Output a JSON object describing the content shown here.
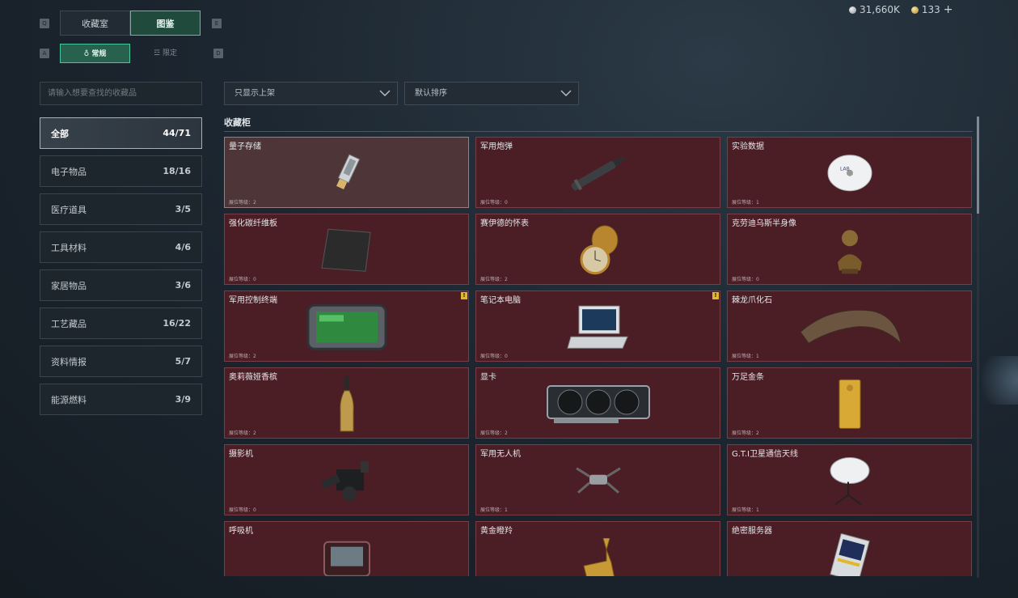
{
  "currency": {
    "silver": "31,660K",
    "gold": "133",
    "plus": "+"
  },
  "keys": {
    "prev_tab": "Q",
    "next_tab": "E",
    "prev_sub": "A",
    "next_sub": "D"
  },
  "tabs": [
    {
      "label": "收藏室"
    },
    {
      "label": "图鉴"
    }
  ],
  "subtabs": [
    {
      "label": "常规"
    },
    {
      "label": "限定"
    }
  ],
  "search": {
    "placeholder": "请输入想要查找的收藏品"
  },
  "categories": [
    {
      "label": "全部",
      "count": "44/71"
    },
    {
      "label": "电子物品",
      "count": "18/16"
    },
    {
      "label": "医疗道具",
      "count": "3/5"
    },
    {
      "label": "工具材料",
      "count": "4/6"
    },
    {
      "label": "家居物品",
      "count": "3/6"
    },
    {
      "label": "工艺藏品",
      "count": "16/22"
    },
    {
      "label": "资料情报",
      "count": "5/7"
    },
    {
      "label": "能源燃料",
      "count": "3/9"
    }
  ],
  "filters": {
    "shelf": "只显示上架",
    "sort": "默认排序"
  },
  "section": {
    "title": "收藏柜"
  },
  "items": [
    {
      "name": "量子存储",
      "level": "展位等级：2",
      "icon": "usb-drive-icon"
    },
    {
      "name": "军用炮弹",
      "level": "展位等级：0",
      "icon": "artillery-shell-icon"
    },
    {
      "name": "实验数据",
      "level": "展位等级：1",
      "icon": "disc-icon"
    },
    {
      "name": "强化碳纤维板",
      "level": "展位等级：0",
      "icon": "carbon-plate-icon"
    },
    {
      "name": "赛伊德的怀表",
      "level": "展位等级：2",
      "icon": "pocket-watch-icon"
    },
    {
      "name": "克劳迪乌斯半身像",
      "level": "展位等级：0",
      "icon": "bust-icon"
    },
    {
      "name": "军用控制终端",
      "level": "展位等级：2",
      "icon": "control-terminal-icon",
      "badge": "!"
    },
    {
      "name": "笔记本电脑",
      "level": "展位等级：0",
      "icon": "laptop-icon",
      "badge": "!"
    },
    {
      "name": "棘龙爪化石",
      "level": "展位等级：1",
      "icon": "claw-fossil-icon"
    },
    {
      "name": "奥莉薇娅香槟",
      "level": "展位等级：2",
      "icon": "champagne-icon"
    },
    {
      "name": "显卡",
      "level": "展位等级：2",
      "icon": "graphics-card-icon"
    },
    {
      "name": "万足金条",
      "level": "展位等级：2",
      "icon": "gold-bar-icon"
    },
    {
      "name": "摄影机",
      "level": "展位等级：0",
      "icon": "camera-icon"
    },
    {
      "name": "军用无人机",
      "level": "展位等级：1",
      "icon": "drone-icon"
    },
    {
      "name": "G.T.I卫星通信天线",
      "level": "展位等级：1",
      "icon": "satellite-dish-icon"
    },
    {
      "name": "呼吸机",
      "level": "",
      "icon": "ventilator-icon"
    },
    {
      "name": "黄金瞪羚",
      "level": "",
      "icon": "gold-gazelle-icon"
    },
    {
      "name": "绝密服务器",
      "level": "",
      "icon": "server-icon"
    }
  ]
}
